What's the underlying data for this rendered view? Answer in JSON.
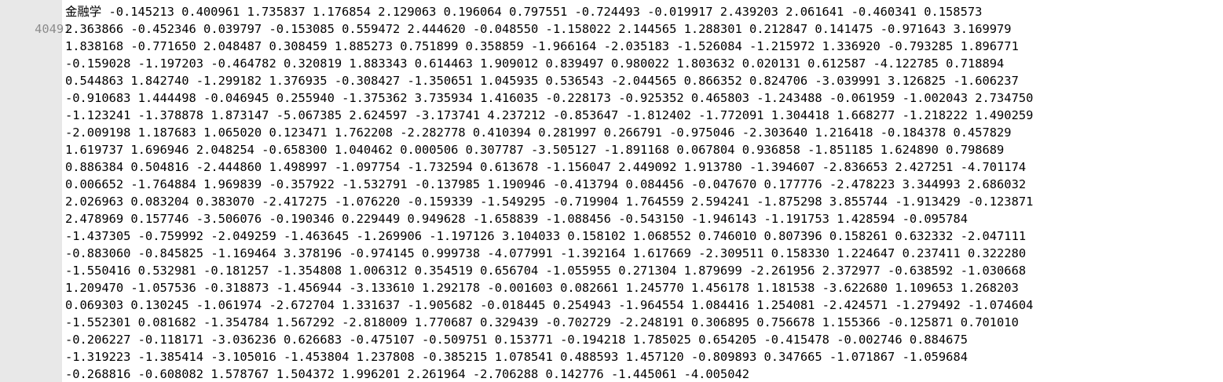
{
  "editor": {
    "line_number": "40491",
    "first_word": "金融学",
    "first_line_rest": " -0.145213 0.400961 1.735837 1.176854 2.129063 0.196064 0.797551 -0.724493 -0.019917 2.439203 2.061641 -0.460341 0.158573",
    "lines": [
      "2.363866 -0.452346 0.039797 -0.153085 0.559472 2.444620 -0.048550 -1.158022 2.144565 1.288301 0.212847 0.141475 -0.971643 3.169979",
      "1.838168 -0.771650 2.048487 0.308459 1.885273 0.751899 0.358859 -1.966164 -2.035183 -1.526084 -1.215972 1.336920 -0.793285 1.896771",
      "-0.159028 -1.197203 -0.464782 0.320819 1.883343 0.614463 1.909012 0.839497 0.980022 1.803632 0.020131 0.612587 -4.122785 0.718894",
      "0.544863 1.842740 -1.299182 1.376935 -0.308427 -1.350651 1.045935 0.536543 -2.044565 0.866352 0.824706 -3.039991 3.126825 -1.606237",
      "-0.910683 1.444498 -0.046945 0.255940 -1.375362 3.735934 1.416035 -0.228173 -0.925352 0.465803 -1.243488 -0.061959 -1.002043 2.734750",
      "-1.123241 -1.378878 1.873147 -5.067385 2.624597 -3.173741 4.237212 -0.853647 -1.812402 -1.772091 1.304418 1.668277 -1.218222 1.490259",
      "-2.009198 1.187683 1.065020 0.123471 1.762208 -2.282778 0.410394 0.281997 0.266791 -0.975046 -2.303640 1.216418 -0.184378 0.457829",
      "1.619737 1.696946 2.048254 -0.658300 1.040462 0.000506 0.307787 -3.505127 -1.891168 0.067804 0.936858 -1.851185 1.624890 0.798689",
      "0.886384 0.504816 -2.444860 1.498997 -1.097754 -1.732594 0.613678 -1.156047 2.449092 1.913780 -1.394607 -2.836653 2.427251 -4.701174",
      "0.006652 -1.764884 1.969839 -0.357922 -1.532791 -0.137985 1.190946 -0.413794 0.084456 -0.047670 0.177776 -2.478223 3.344993 2.686032",
      "2.026963 0.083204 0.383070 -2.417275 -1.076220 -0.159339 -1.549295 -0.719904 1.764559 2.594241 -1.875298 3.855744 -1.913429 -0.123871",
      "2.478969 0.157746 -3.506076 -0.190346 0.229449 0.949628 -1.658839 -1.088456 -0.543150 -1.946143 -1.191753 1.428594 -0.095784",
      "-1.437305 -0.759992 -2.049259 -1.463645 -1.269906 -1.197126 3.104033 0.158102 1.068552 0.746010 0.807396 0.158261 0.632332 -2.047111",
      "-0.883060 -0.845825 -1.169464 3.378196 -0.974145 0.999738 -4.077991 -1.392164 1.617669 -2.309511 0.158330 1.224647 0.237411 0.322280",
      "-1.550416 0.532981 -0.181257 -1.354808 1.006312 0.354519 0.656704 -1.055955 0.271304 1.879699 -2.261956 2.372977 -0.638592 -1.030668",
      "1.209470 -1.057536 -0.318873 -1.456944 -3.133610 1.292178 -0.001603 0.082661 1.245770 1.456178 1.181538 -3.622680 1.109653 1.268203",
      "0.069303 0.130245 -1.061974 -2.672704 1.331637 -1.905682 -0.018445 0.254943 -1.964554 1.084416 1.254081 -2.424571 -1.279492 -1.074604",
      "-1.552301 0.081682 -1.354784 1.567292 -2.818009 1.770687 0.329439 -0.702729 -2.248191 0.306895 0.756678 1.155366 -0.125871 0.701010",
      "-0.206227 -0.118171 -3.036236 0.626683 -0.475107 -0.509751 0.153771 -0.194218 1.785025 0.654205 -0.415478 -0.002746 0.884675",
      "-1.319223 -1.385414 -3.105016 -1.453804 1.237808 -0.385215 1.078541 0.488593 1.457120 -0.809893 0.347665 -1.071867 -1.059684",
      "-0.268816 -0.608082 1.578767 1.504372 1.996201 2.261964 -2.706288 0.142776 -1.445061 -4.005042"
    ]
  }
}
